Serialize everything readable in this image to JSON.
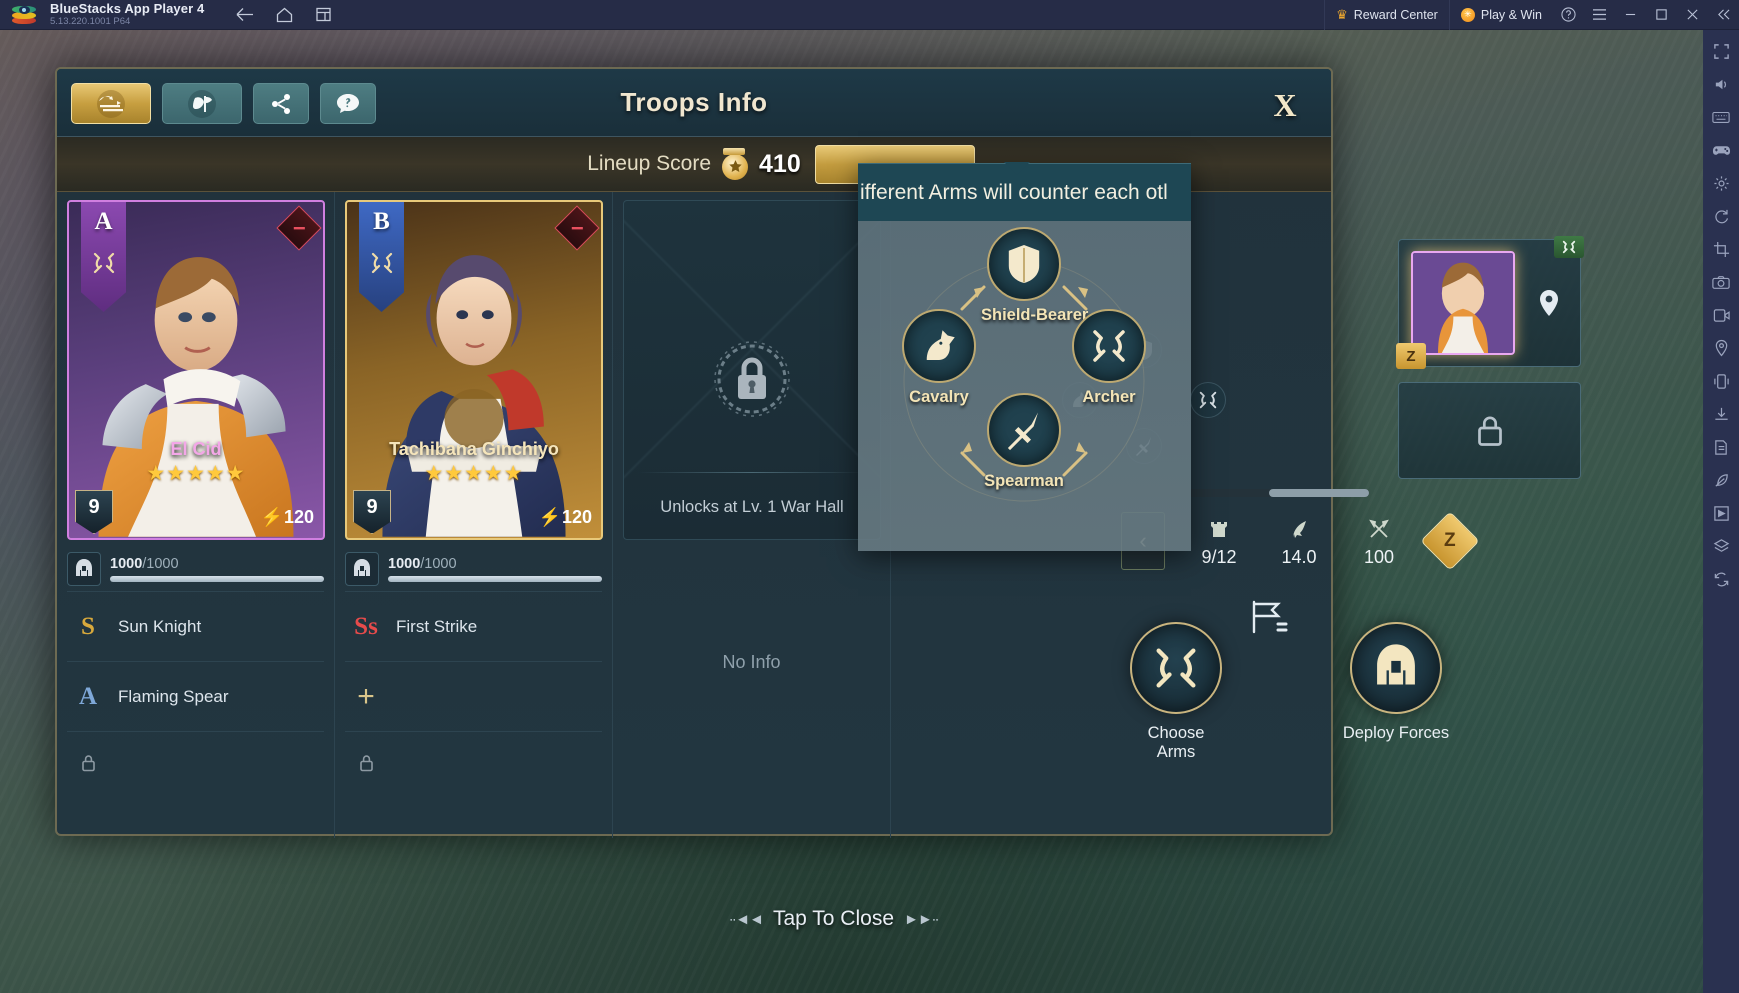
{
  "titlebar": {
    "app_name": "BlueStacks App Player 4",
    "version": "5.13.220.1001  P64",
    "nav": [
      {
        "name": "back",
        "icon": "arrow-left-icon"
      },
      {
        "name": "home",
        "icon": "home-icon"
      },
      {
        "name": "multi-instance",
        "icon": "windows-icon"
      }
    ],
    "reward_center": "Reward Center",
    "play_and_win": "Play & Win",
    "window_buttons": [
      "help-icon",
      "menu-icon",
      "minimize-icon",
      "maximize-icon",
      "close-icon",
      "collapse-icon"
    ]
  },
  "dialog": {
    "title": "Troops Info",
    "close_label": "X",
    "tabs": [
      {
        "name": "tab-troops",
        "icon": "helmet-swap-icon",
        "state": "active"
      },
      {
        "name": "tab-formation",
        "icon": "helmet-flag-icon",
        "state": "inactive"
      },
      {
        "name": "tab-share",
        "icon": "share-icon",
        "state": "inactive"
      },
      {
        "name": "tab-help",
        "icon": "question-icon",
        "state": "inactive"
      }
    ],
    "score": {
      "label": "Lineup Score",
      "value": "410",
      "icon": "star-medal-icon"
    }
  },
  "heroes": [
    {
      "rank": "A",
      "arm_icon": "bow-icon",
      "name": "El Cid",
      "stars": 5,
      "level": "9",
      "power": "120",
      "troops_current": "1000",
      "troops_separator": "/",
      "troops_max": "1000",
      "troops_pct": 100,
      "skills": [
        {
          "grade": "S",
          "grade_class": "s",
          "name": "Sun Knight"
        },
        {
          "grade": "A",
          "grade_class": "a",
          "name": "Flaming Spear"
        }
      ],
      "locked_icon": "lock-icon",
      "remove_icon": "minus-icon"
    },
    {
      "rank": "B",
      "arm_icon": "bow-icon",
      "name": "Tachibana Ginchiyo",
      "stars": 5,
      "level": "9",
      "power": "120",
      "troops_current": "1000",
      "troops_separator": "/",
      "troops_max": "1000",
      "troops_pct": 100,
      "skills": [
        {
          "grade": "Ss",
          "grade_class": "ss",
          "name": "First Strike"
        },
        {
          "grade": "+",
          "grade_class": "plus",
          "name": ""
        }
      ],
      "locked_icon": "lock-icon",
      "remove_icon": "minus-icon"
    }
  ],
  "locked_slot": {
    "lock_icon": "chained-padlock-icon",
    "caption": "Unlocks at Lv. 1 War Hall",
    "no_info": "No Info"
  },
  "stats": {
    "prev_arrow": "‹",
    "cells": [
      {
        "icon": "castle-icon",
        "value": "9/12"
      },
      {
        "icon": "speed-icon",
        "value": "14.0"
      },
      {
        "icon": "axes-icon",
        "value": "100"
      }
    ],
    "arm_token": "Z"
  },
  "actions": [
    {
      "label": "Choose\nArms",
      "label_line1": "Choose",
      "label_line2": "Arms",
      "icon": "bow-icon"
    },
    {
      "label": "Deploy Forces",
      "label_line1": "Deploy Forces",
      "label_line2": "",
      "icon": "helmet-icon"
    }
  ],
  "tooltip": {
    "text": "ifferent Arms will counter each otl",
    "nodes": [
      {
        "name": "Shield-Bearer",
        "icon": "shield-icon"
      },
      {
        "name": "Cavalry",
        "icon": "horse-icon"
      },
      {
        "name": "Archer",
        "icon": "bow-icon"
      },
      {
        "name": "Spearman",
        "icon": "spear-icon"
      }
    ]
  },
  "hud": {
    "hero_badge_arm": "bow-icon",
    "hero_badge_level": "Z",
    "pin_icon": "location-pin-icon",
    "lock_icon": "lock-icon"
  },
  "bottom": {
    "tap_to_close": "Tap To Close"
  },
  "rail": [
    "fullscreen-icon",
    "volume-icon",
    "keyboard-icon",
    "gamepad-icon",
    "settings-icon",
    "rotate-icon",
    "trim-icon",
    "camera-icon",
    "record-icon",
    "location-icon",
    "shake-icon",
    "install-icon",
    "script-icon",
    "eco-icon",
    "macro-icon",
    "layers-icon",
    "sync-icon"
  ],
  "colors": {
    "gold": "#d9c184",
    "accent_purple": "#d07fe0",
    "accent_gold": "#e8c97a",
    "teal": "#1e4754",
    "titlebar": "#262c47"
  }
}
